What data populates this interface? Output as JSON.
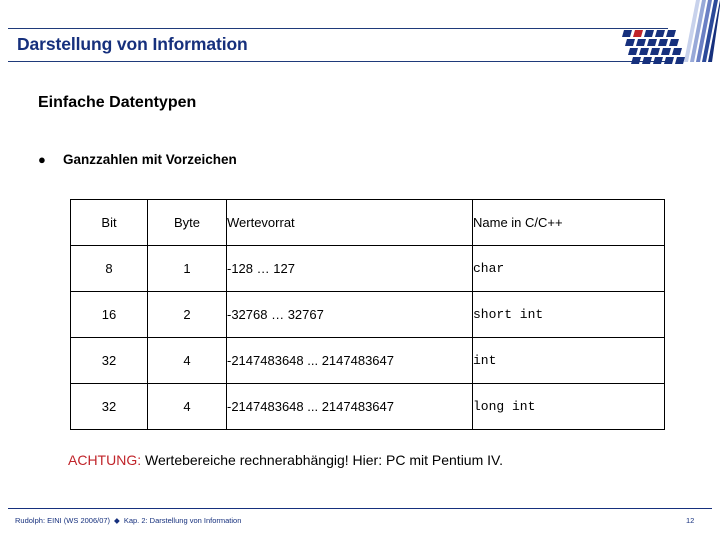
{
  "header": {
    "title": "Darstellung von Information",
    "logo_name": "tu-dortmund-logo",
    "title_color": "#16307d",
    "rule_color": "#1f3a7a"
  },
  "content": {
    "heading": "Einfache Datentypen",
    "bullet": {
      "marker": "●",
      "label": "Ganzzahlen mit Vorzeichen"
    }
  },
  "table": {
    "headers": [
      "Bit",
      "Byte",
      "Wertevorrat",
      "Name in C/C++"
    ],
    "rows": [
      {
        "bit": "8",
        "byte": "1",
        "range": "-128 … 127",
        "name": "char"
      },
      {
        "bit": "16",
        "byte": "2",
        "range": "-32768 … 32767",
        "name": "short int"
      },
      {
        "bit": "32",
        "byte": "4",
        "range": "-2147483648 ... 2147483647",
        "name": "int"
      },
      {
        "bit": "32",
        "byte": "4",
        "range": "-2147483648 ... 2147483647",
        "name": "long int"
      }
    ]
  },
  "note": {
    "warning": "ACHTUNG:",
    "warning_color": "#c0242a",
    "text": " Wertebereiche rechnerabhängig! Hier: PC mit Pentium IV."
  },
  "footer": {
    "author_course": "Rudolph: EINI (WS 2006/07)",
    "separator": "◆",
    "chapter": "Kap. 2: Darstellung von Information",
    "page_number": "12",
    "color": "#16307d"
  }
}
